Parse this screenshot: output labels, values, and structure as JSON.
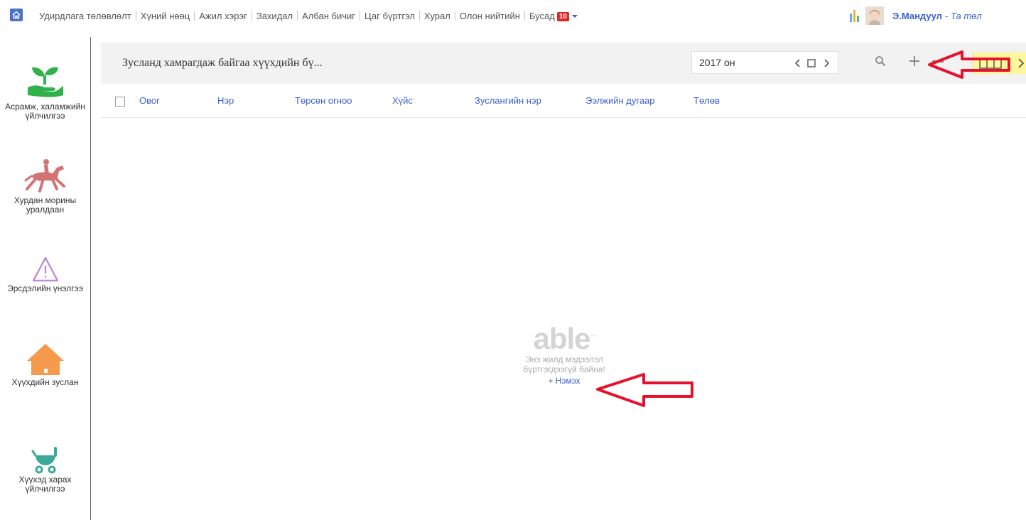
{
  "topnav": {
    "items": [
      "Удирдлага төлөвлөлт",
      "Хүний нөөц",
      "Ажил хэрэг",
      "Захидал",
      "Албан бичиг",
      "Цаг бүртгэл",
      "Хурал",
      "Олон нийтийн",
      "Бусад"
    ],
    "badge": "10",
    "user_name": "Э.Мандуул",
    "user_sub": "- Та төл"
  },
  "sidebar": {
    "items": [
      {
        "label": "Асрамж, халамжийн үйлчилгээ",
        "icon": "hand-plant-icon",
        "color": "#2fb24a"
      },
      {
        "label": "Хурдан морины уралдаан",
        "icon": "horse-rider-icon",
        "color": "#d37474"
      },
      {
        "label": "Эрсдэлийн үнэлгээ",
        "icon": "warning-triangle-icon",
        "color": "#c38bd8"
      },
      {
        "label": "Хүүхдийн зуслан",
        "icon": "house-icon",
        "color": "#f5994d"
      },
      {
        "label": "Хүүхэд харах үйлчилгээ",
        "icon": "stroller-icon",
        "color": "#3aa99a"
      }
    ]
  },
  "main": {
    "title": "Зусланд хамрагдаж байгаа хүүхдийн бү...",
    "year": "2017 он",
    "columns": [
      "Овог",
      "Нэр",
      "Төрсөн огноо",
      "Хүйс",
      "Зуслангийн нэр",
      "Ээлжийн дугаар",
      "Төлөв"
    ],
    "empty": {
      "logo": "able",
      "tm": "™",
      "line1": "Энэ жилд мэдээлэл",
      "line2": "бүртгэгдээгүй байна!",
      "add": "+ Нэмэх"
    }
  },
  "colors": {
    "accent": "#3a5fcd",
    "annotation": "#e8112d",
    "toolbar_bg": "#f2f2f2",
    "view_toggle": "#fff89a"
  }
}
